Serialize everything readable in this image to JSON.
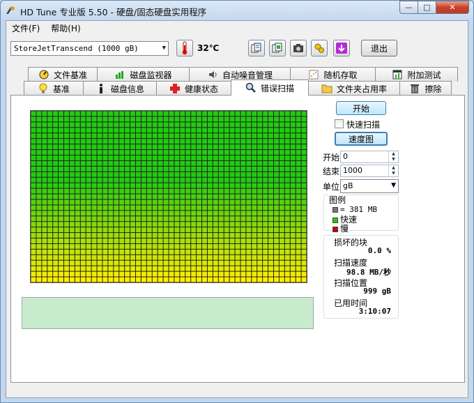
{
  "window": {
    "title": "HD Tune 专业版 5.50 - 硬盘/固态硬盘实用程序",
    "minimize": "—",
    "maximize": "□",
    "close": "✕"
  },
  "menu": [
    "文件(F)",
    "帮助(H)"
  ],
  "toolbar": {
    "drive": "StoreJetTranscend (1000 gB)",
    "temperature": "32℃",
    "exit_label": "退出",
    "icons": [
      "copy-info-icon",
      "copy-screen-icon",
      "camera-icon",
      "options-icon",
      "save-down-icon"
    ]
  },
  "tabs_row1": [
    "文件基准",
    "磁盘监视器",
    "自动噪音管理",
    "随机存取",
    "附加测试"
  ],
  "tabs_row2": [
    "基准",
    "磁盘信息",
    "健康状态",
    "错误扫描",
    "文件夹占用率",
    "擦除"
  ],
  "active_tab": "错误扫描",
  "scan": {
    "start_button": "开始",
    "quick_scan_label": "快速扫描",
    "quick_scan_checked": false,
    "speed_map_button": "速度图",
    "start_label": "开始",
    "start_value": "0",
    "end_label": "结束",
    "end_value": "1000",
    "unit_label": "单位",
    "unit_value": "gB",
    "legend_title": "图例",
    "legend_block": "= 381 MB",
    "legend_fast": "快速",
    "legend_slow": "慢",
    "colors": {
      "ok": "#33cc00",
      "slow": "#cc0000",
      "grid_top": "#22cc11",
      "grid_bottom": "#ffee00"
    },
    "stats": {
      "damaged_label": "损坏的块",
      "damaged_value": "0.0 %",
      "speed_label": "扫描速度",
      "speed_value": "98.8 MB/秒",
      "position_label": "扫描位置",
      "position_value": "999 gB",
      "elapsed_label": "已用时间",
      "elapsed_value": "3:10:07"
    }
  }
}
